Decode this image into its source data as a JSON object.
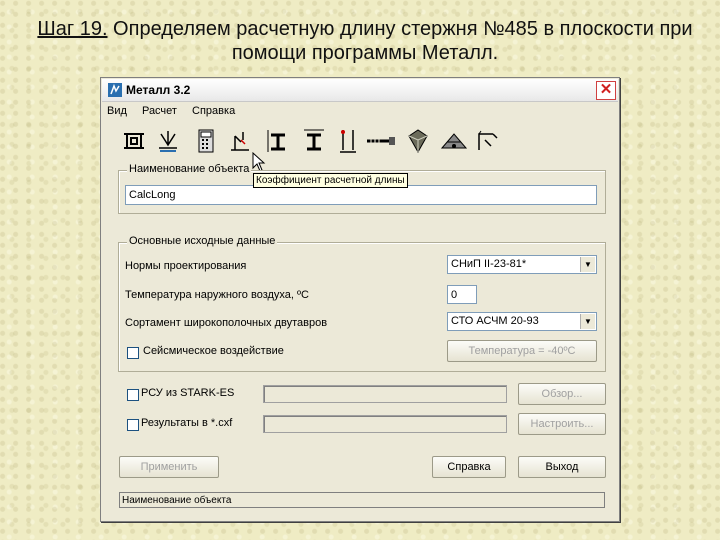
{
  "slide": {
    "title_lead": "Шаг 19.",
    "title_rest": " Определяем расчетную длину стержня №485 в плоскости при помощи программы Металл."
  },
  "window": {
    "title": "Металл 3.2",
    "close_glyph": "✕",
    "menu": [
      "Вид",
      "Расчет",
      "Справка"
    ],
    "toolbar_icons": [
      "beam-section-icon",
      "spring-support-icon",
      "calculator-icon",
      "node-displacement-icon",
      "i-beam-icon",
      "i-beam-column-icon",
      "column-support-icon",
      "bolt-icon",
      "polyhedron-icon",
      "truss-node-icon",
      "frame-node-icon"
    ],
    "tooltip": "Коэффициент расчетной длины",
    "object_group": {
      "label": "Наименование объекта",
      "value": "CalcLong"
    },
    "source_group": {
      "label": "Основные исходные данные",
      "norms_label": "Нормы проектирования",
      "norms_value": "СНиП II-23-81*",
      "temp_label": "Температура наружного воздуха, ºС",
      "temp_value": "0",
      "assortment_label": "Сортамент широкополочных двутавров",
      "assortment_value": "СТО АСЧМ 20-93",
      "seismic_label": "Сейсмическое воздействие",
      "temp_button": "Температура = -40ºС"
    },
    "rsu_label": "РСУ из STARK-ES",
    "rsu_button": "Обзор...",
    "results_label": "Результаты в *.cxf",
    "results_button": "Настроить...",
    "apply_button": "Применить",
    "help_button": "Справка",
    "exit_button": "Выход",
    "status": "Наименование объекта"
  }
}
